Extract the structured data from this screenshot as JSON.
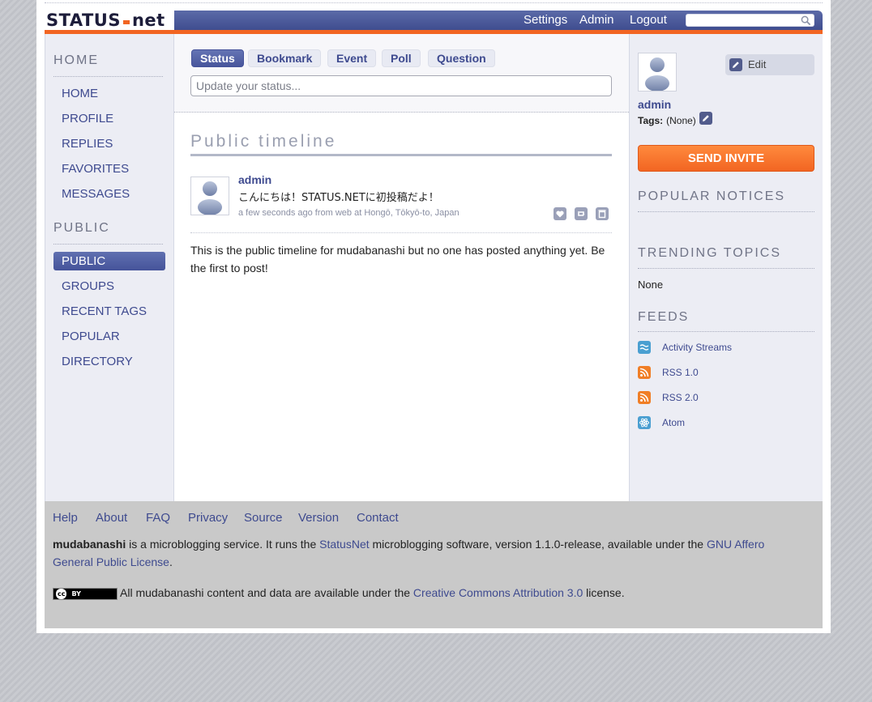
{
  "header": {
    "logo": {
      "left": "STATUS",
      "right": "net"
    },
    "nav": [
      "Settings",
      "Admin",
      "Logout"
    ],
    "search_placeholder": ""
  },
  "left_sidebar": {
    "home_heading": "HOME",
    "home_items": [
      "HOME",
      "PROFILE",
      "REPLIES",
      "FAVORITES",
      "MESSAGES"
    ],
    "public_heading": "PUBLIC",
    "public_items": [
      "PUBLIC",
      "GROUPS",
      "RECENT TAGS",
      "POPULAR",
      "DIRECTORY"
    ],
    "active_item": "PUBLIC"
  },
  "composer": {
    "tabs": [
      "Status",
      "Bookmark",
      "Event",
      "Poll",
      "Question"
    ],
    "active_tab": "Status",
    "placeholder": "Update your status..."
  },
  "timeline": {
    "title": "Public timeline",
    "notice": {
      "author": "admin",
      "text": "こんにちは！STATUS.NETに初投稿だよ！",
      "time": "a few seconds ago",
      "from_label": "from",
      "source": "web",
      "at_label": "at",
      "location": "Hongō, Tōkyō-to, Japan"
    },
    "empty_message": "This is the public timeline for mudabanashi but no one has posted anything yet. Be the first to post!"
  },
  "right_sidebar": {
    "edit_label": "Edit",
    "profile_name": "admin",
    "tags_label": "Tags:",
    "tags_value": "(None)",
    "invite_label": "SEND INVITE",
    "popular_heading": "POPULAR NOTICES",
    "trending_heading": "TRENDING TOPICS",
    "trending_value": "None",
    "feeds_heading": "FEEDS",
    "feeds": [
      {
        "label": "Activity Streams",
        "color": "#4a9fd1"
      },
      {
        "label": "RSS 1.0",
        "color": "#f07e26"
      },
      {
        "label": "RSS 2.0",
        "color": "#f07e26"
      },
      {
        "label": "Atom",
        "color": "#4a9fd1"
      }
    ]
  },
  "footer": {
    "links": [
      "Help",
      "About",
      "FAQ",
      "Privacy",
      "Source",
      "Version",
      "Contact"
    ],
    "site_name": "mudabanashi",
    "text_a": " is a microblogging service. It runs the ",
    "statusnet_link": "StatusNet",
    "text_b": " microblogging software, version 1.1.0-release, available under the ",
    "agpl_link": "GNU Affero General Public License",
    "text_c": ".",
    "cc_badge": "BY",
    "license_a": "All mudabanashi content and data are available under the ",
    "cc_link": "Creative Commons Attribution 3.0",
    "license_b": " license."
  },
  "colors": {
    "brand_blue": "#3e4a8f",
    "brand_orange": "#f26522"
  }
}
